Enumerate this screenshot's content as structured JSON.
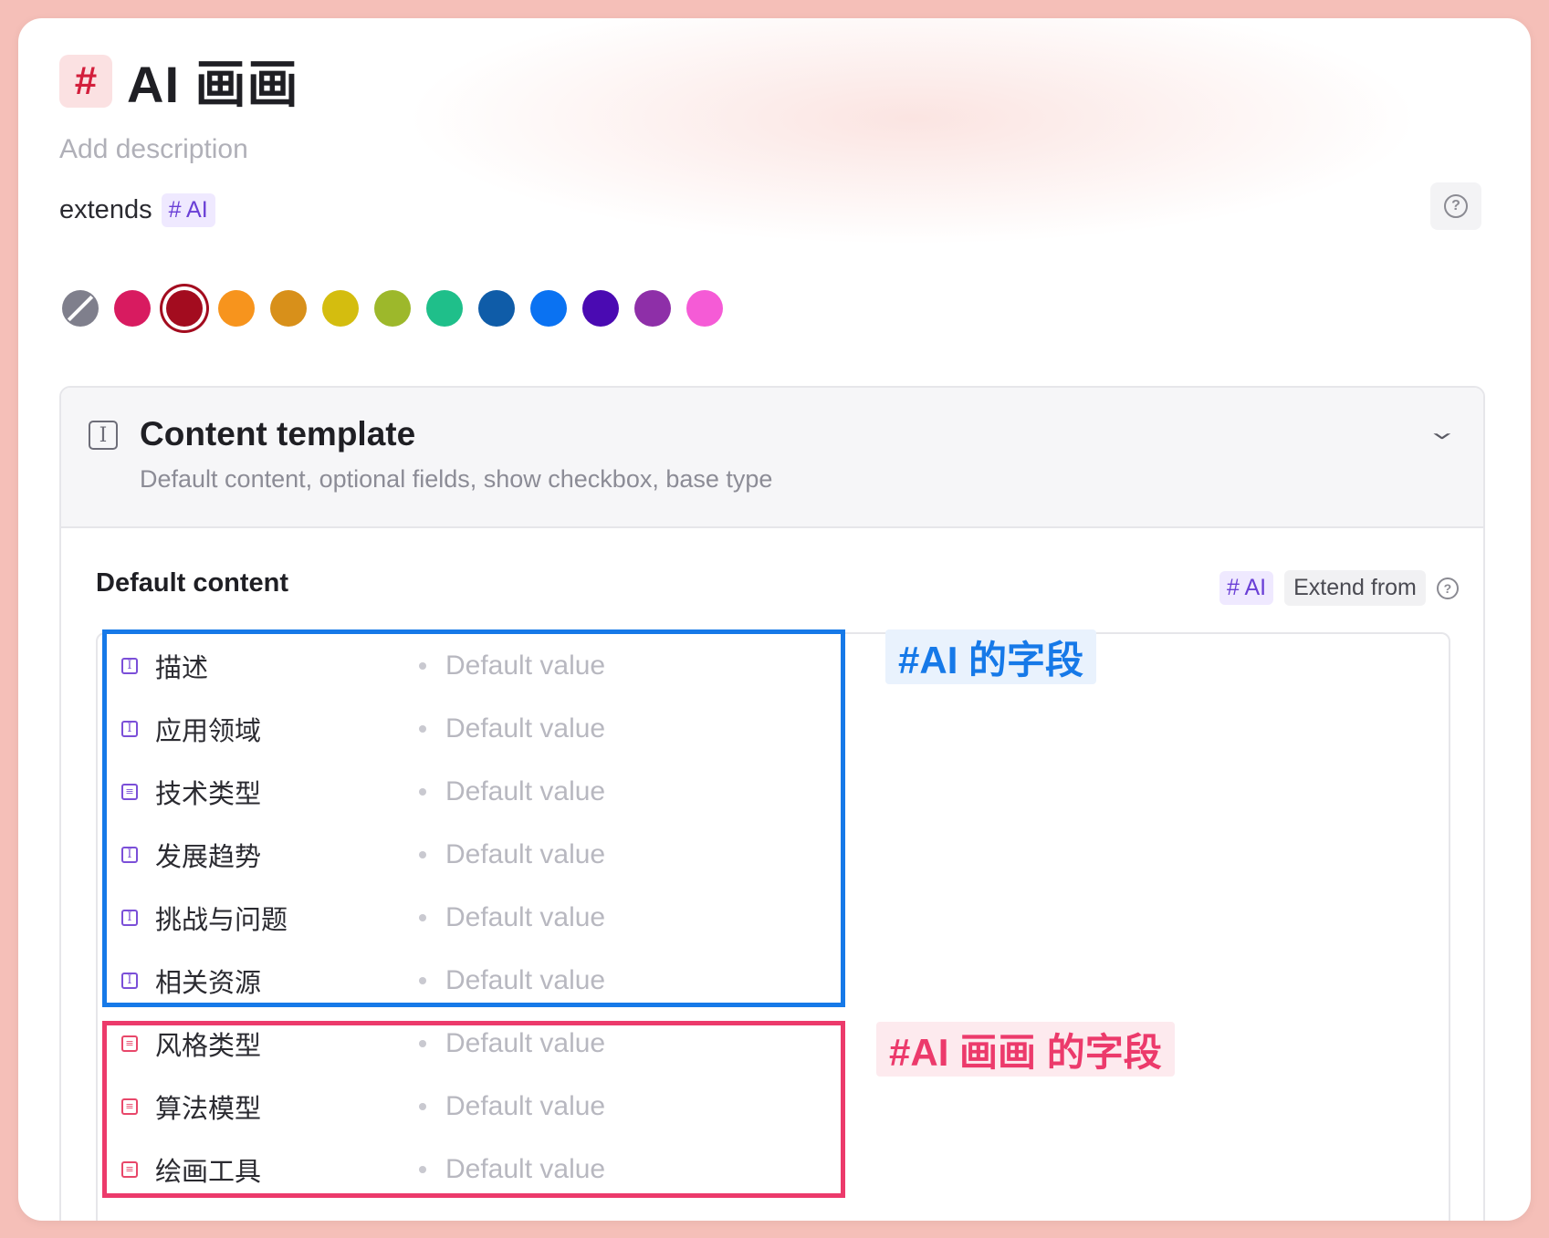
{
  "header": {
    "hash_symbol": "#",
    "title": "AI 画画",
    "description_placeholder": "Add description",
    "extends_label": "extends",
    "extends_tag": "# AI",
    "help_symbol": "?"
  },
  "color_picker": {
    "selected_index": 2,
    "swatches": [
      {
        "name": "none",
        "color": "#7f7f8c"
      },
      {
        "name": "crimson",
        "color": "#d81b60"
      },
      {
        "name": "dark-red",
        "color": "#a30c1f"
      },
      {
        "name": "orange",
        "color": "#f7941d"
      },
      {
        "name": "amber",
        "color": "#d8901a"
      },
      {
        "name": "yellow",
        "color": "#d4bd0f"
      },
      {
        "name": "olive",
        "color": "#9db82b"
      },
      {
        "name": "teal",
        "color": "#1fbf8a"
      },
      {
        "name": "navy",
        "color": "#0f5ca8"
      },
      {
        "name": "blue",
        "color": "#0a72f2"
      },
      {
        "name": "indigo",
        "color": "#4a0ab2"
      },
      {
        "name": "purple",
        "color": "#8e2fa8"
      },
      {
        "name": "pink",
        "color": "#f55bd6"
      }
    ]
  },
  "content_template": {
    "icon": "text-cursor-icon",
    "title": "Content template",
    "subtitle": "Default content, optional fields, show checkbox, base type",
    "chevron": "›"
  },
  "default_content": {
    "label": "Default content",
    "tag": "# AI",
    "extend_button": "Extend from",
    "help_symbol": "?"
  },
  "fields": [
    {
      "icon": "text",
      "name": "描述",
      "value": "Default value",
      "group": "ai"
    },
    {
      "icon": "text",
      "name": "应用领域",
      "value": "Default value",
      "group": "ai"
    },
    {
      "icon": "list",
      "name": "技术类型",
      "value": "Default value",
      "group": "ai"
    },
    {
      "icon": "text",
      "name": "发展趋势",
      "value": "Default value",
      "group": "ai"
    },
    {
      "icon": "text",
      "name": "挑战与问题",
      "value": "Default value",
      "group": "ai"
    },
    {
      "icon": "text",
      "name": "相关资源",
      "value": "Default value",
      "group": "ai"
    },
    {
      "icon": "list",
      "name": "风格类型",
      "value": "Default value",
      "group": "ai-painting"
    },
    {
      "icon": "list",
      "name": "算法模型",
      "value": "Default value",
      "group": "ai-painting"
    },
    {
      "icon": "list",
      "name": "绘画工具",
      "value": "Default value",
      "group": "ai-painting"
    }
  ],
  "annotations": {
    "blue_label": "#AI 的字段",
    "pink_label": "#AI 画画 的字段",
    "blue_color": "#1679e8",
    "pink_color": "#ec3a6b"
  },
  "icon_colors": {
    "ai": "#7b4fd8",
    "ai-painting": "#e8476a"
  }
}
